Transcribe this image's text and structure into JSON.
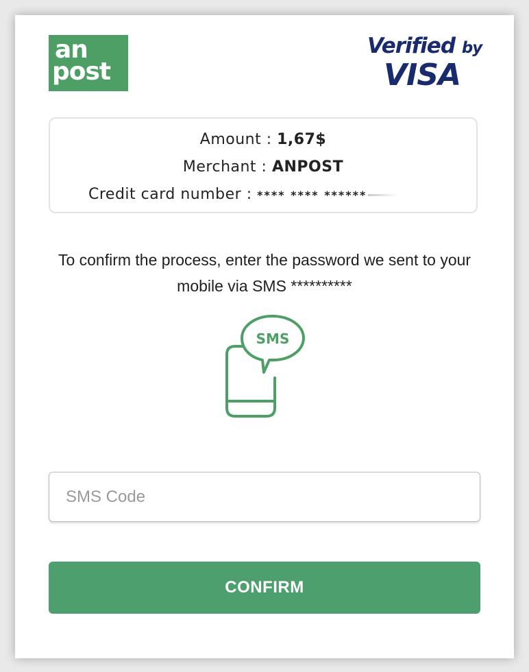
{
  "branding": {
    "anpost_logo_line1": "an",
    "anpost_logo_line2": "post",
    "visa_verified": "Verified",
    "visa_by": "by",
    "visa_name": "VISA"
  },
  "summary": {
    "amount_label": "Amount : ",
    "amount_value": "1,67$",
    "merchant_label": "Merchant : ",
    "merchant_value": "ANPOST",
    "card_label": "Credit card number : ",
    "card_value": "**** **** ******"
  },
  "instruction": "To confirm the process, enter the password we sent to your mobile via SMS **********",
  "sms_icon_text": "SMS",
  "sms_input": {
    "placeholder": "SMS Code",
    "value": ""
  },
  "confirm_button": "CONFIRM",
  "colors": {
    "brand_green": "#4e9f66",
    "button_green": "#4e9f6e",
    "visa_blue": "#1a2b6d"
  }
}
